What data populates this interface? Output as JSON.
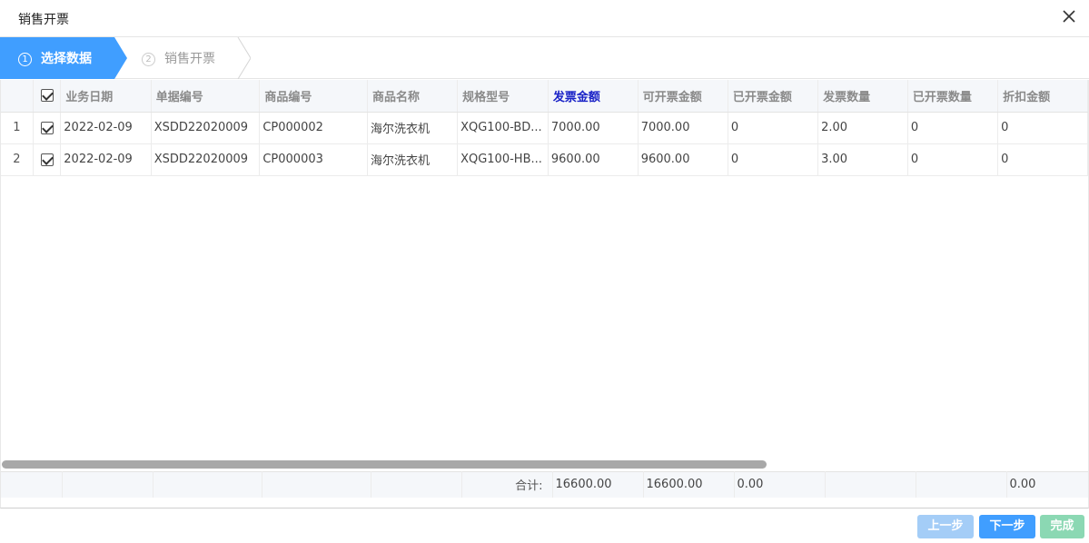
{
  "dialog": {
    "title": "销售开票",
    "close_icon": "close-icon"
  },
  "steps": [
    {
      "num": "1",
      "label": "选择数据",
      "active": true
    },
    {
      "num": "2",
      "label": "销售开票",
      "active": false
    }
  ],
  "table": {
    "columns": [
      "业务日期",
      "单据编号",
      "商品编号",
      "商品名称",
      "规格型号",
      "发票金额",
      "可开票金额",
      "已开票金额",
      "发票数量",
      "已开票数量",
      "折扣金额"
    ],
    "highlight_column": "发票金额",
    "highlight_color": "#1a23c7",
    "rows": [
      {
        "idx": "1",
        "checked": true,
        "date": "2022-02-09",
        "doc_no": "XSDD22020009",
        "item_no": "CP000002",
        "item_name": "海尔洗衣机",
        "spec": "XQG100-BD...",
        "invoice_amt": "7000.00",
        "avail_amt": "7000.00",
        "invoiced_amt": "0",
        "invoice_qty": "2.00",
        "invoiced_qty": "0",
        "discount": "0"
      },
      {
        "idx": "2",
        "checked": true,
        "date": "2022-02-09",
        "doc_no": "XSDD22020009",
        "item_no": "CP000003",
        "item_name": "海尔洗衣机",
        "spec": "XQG100-HB...",
        "invoice_amt": "9600.00",
        "avail_amt": "9600.00",
        "invoiced_amt": "0",
        "invoice_qty": "3.00",
        "invoiced_qty": "0",
        "discount": "0"
      }
    ],
    "footer": {
      "label": "合计:",
      "invoice_amt": "16600.00",
      "avail_amt": "16600.00",
      "invoiced_amt": "0.00",
      "discount": "0.00"
    }
  },
  "buttons": {
    "prev": "上一步",
    "next": "下一步",
    "done": "完成"
  },
  "colors": {
    "step_active": "#409eff",
    "btn_next": "#409eff",
    "btn_prev": "#a4cdf7",
    "btn_done": "#8bd8b3"
  }
}
